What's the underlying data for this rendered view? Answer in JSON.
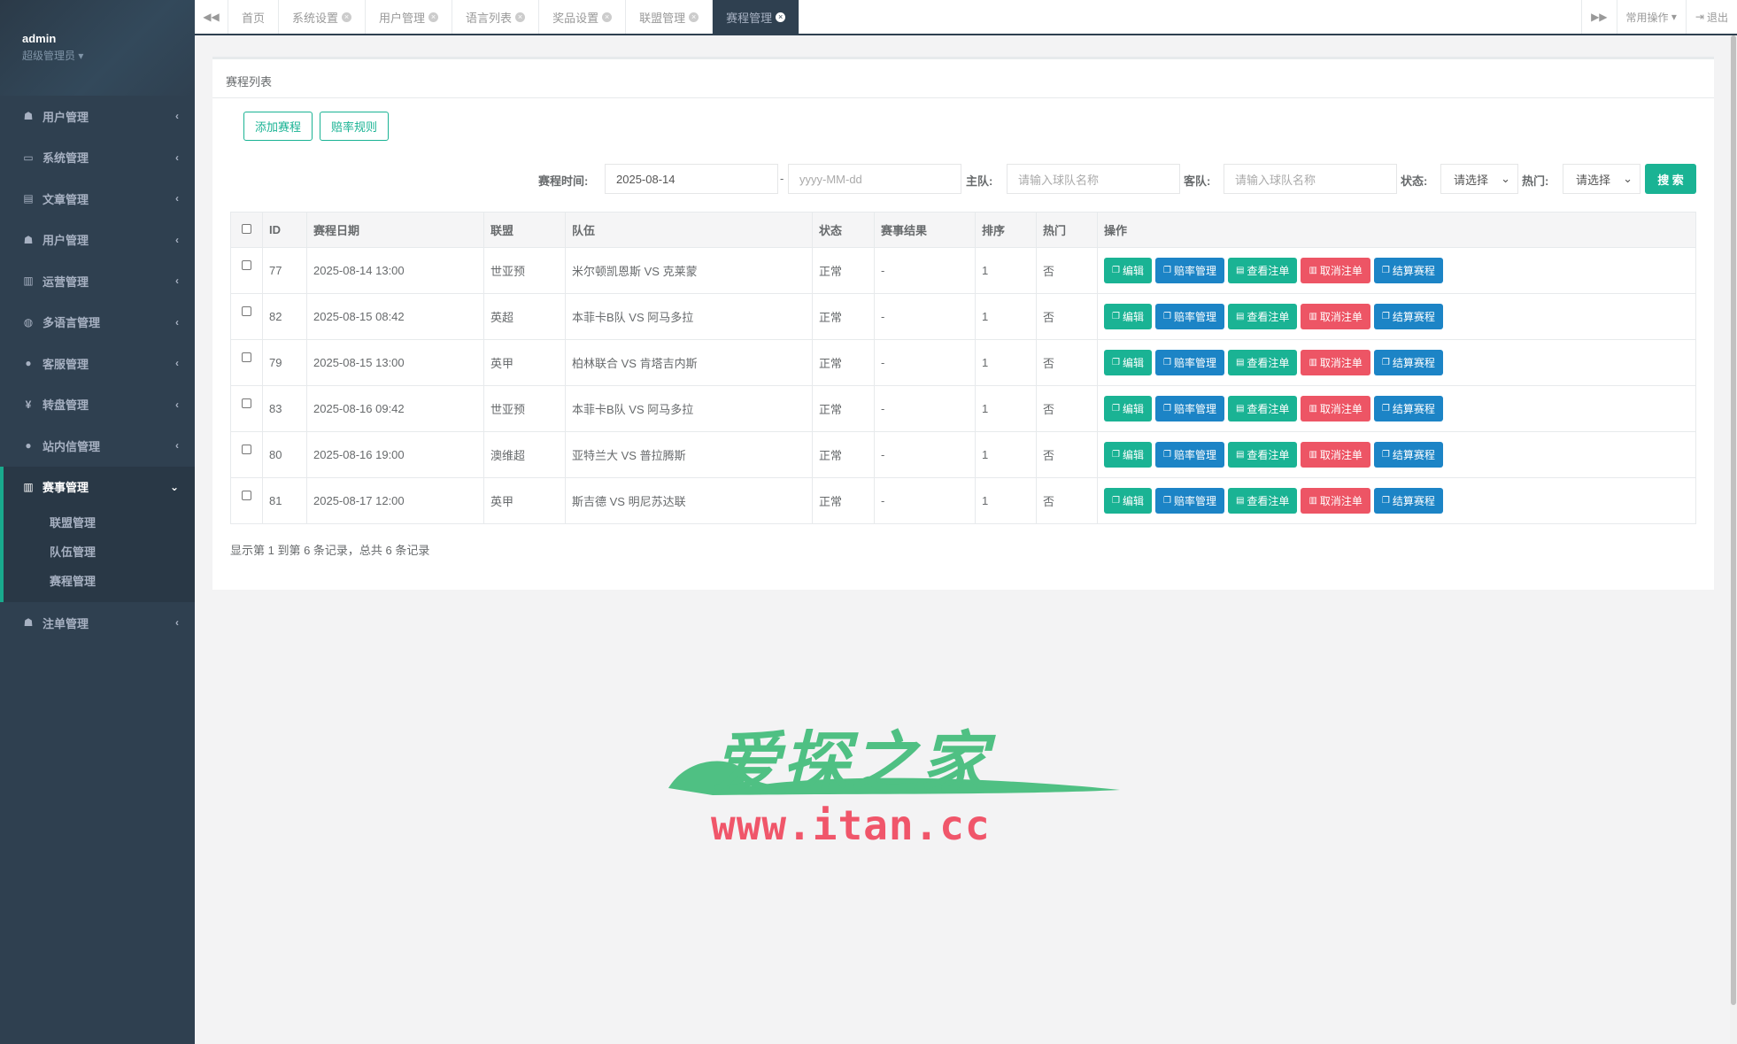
{
  "user": {
    "name": "admin",
    "role": "超级管理员"
  },
  "sidebar": {
    "items": [
      {
        "icon": "users-icon",
        "glyph": "☗",
        "label": "用户管理"
      },
      {
        "icon": "desktop-icon",
        "glyph": "▭",
        "label": "系统管理"
      },
      {
        "icon": "book-icon",
        "glyph": "▤",
        "label": "文章管理"
      },
      {
        "icon": "user-icon",
        "glyph": "☗",
        "label": "用户管理"
      },
      {
        "icon": "bar-chart-icon",
        "glyph": "▥",
        "label": "运营管理"
      },
      {
        "icon": "globe-icon",
        "glyph": "◍",
        "label": "多语言管理"
      },
      {
        "icon": "comment-icon",
        "glyph": "●",
        "label": "客服管理"
      },
      {
        "icon": "yen-icon",
        "glyph": "¥",
        "label": "转盘管理"
      },
      {
        "icon": "comment-icon",
        "glyph": "●",
        "label": "站内信管理"
      }
    ],
    "active_group": {
      "icon": "bar-chart-icon",
      "glyph": "▥",
      "label": "赛事管理",
      "children": [
        "联盟管理",
        "队伍管理",
        "赛程管理"
      ]
    },
    "after": [
      {
        "icon": "user-icon",
        "glyph": "☗",
        "label": "注单管理"
      }
    ]
  },
  "tabs": [
    {
      "label": "首页",
      "closable": false
    },
    {
      "label": "系统设置",
      "closable": true
    },
    {
      "label": "用户管理",
      "closable": true
    },
    {
      "label": "语言列表",
      "closable": true
    },
    {
      "label": "奖品设置",
      "closable": true
    },
    {
      "label": "联盟管理",
      "closable": true
    },
    {
      "label": "赛程管理",
      "closable": true,
      "active": true
    }
  ],
  "toolbar": {
    "common_ops": "常用操作",
    "logout": "退出"
  },
  "page": {
    "title": "赛程列表",
    "add_button": "添加赛程",
    "odds_rule_button": "赔率规则"
  },
  "filters": {
    "time_label": "赛程时间:",
    "time_start": "2025-08-14",
    "dash": "-",
    "time_end_placeholder": "yyyy-MM-dd",
    "home_label": "主队:",
    "home_placeholder": "请输入球队名称",
    "away_label": "客队:",
    "away_placeholder": "请输入球队名称",
    "status_label": "状态:",
    "status_value": "请选择",
    "hot_label": "热门:",
    "hot_value": "请选择",
    "search_button": "搜 索"
  },
  "table": {
    "headers": [
      "ID",
      "赛程日期",
      "联盟",
      "队伍",
      "状态",
      "赛事结果",
      "排序",
      "热门",
      "操作"
    ],
    "rows": [
      {
        "id": "77",
        "date": "2025-08-14 13:00",
        "league": "世亚预",
        "teams": "米尔顿凯恩斯  VS  克莱蒙",
        "status": "正常",
        "result": "-",
        "sort": "1",
        "hot": "否"
      },
      {
        "id": "82",
        "date": "2025-08-15 08:42",
        "league": "英超",
        "teams": "本菲卡B队  VS  阿马多拉",
        "status": "正常",
        "result": "-",
        "sort": "1",
        "hot": "否"
      },
      {
        "id": "79",
        "date": "2025-08-15 13:00",
        "league": "英甲",
        "teams": "柏林联合  VS  肯塔吉内斯",
        "status": "正常",
        "result": "-",
        "sort": "1",
        "hot": "否"
      },
      {
        "id": "83",
        "date": "2025-08-16 09:42",
        "league": "世亚预",
        "teams": "本菲卡B队  VS  阿马多拉",
        "status": "正常",
        "result": "-",
        "sort": "1",
        "hot": "否"
      },
      {
        "id": "80",
        "date": "2025-08-16 19:00",
        "league": "澳维超",
        "teams": "亚特兰大  VS  普拉腾斯",
        "status": "正常",
        "result": "-",
        "sort": "1",
        "hot": "否"
      },
      {
        "id": "81",
        "date": "2025-08-17 12:00",
        "league": "英甲",
        "teams": "斯吉德  VS  明尼苏达联",
        "status": "正常",
        "result": "-",
        "sort": "1",
        "hot": "否"
      }
    ],
    "actions": [
      {
        "label": "编辑",
        "color": "green",
        "icon": "copy-icon"
      },
      {
        "label": "赔率管理",
        "color": "blue",
        "icon": "copy-icon"
      },
      {
        "label": "查看注单",
        "color": "green",
        "icon": "list-icon"
      },
      {
        "label": "取消注单",
        "color": "red",
        "icon": "trash-icon"
      },
      {
        "label": "结算赛程",
        "color": "blue",
        "icon": "copy-icon"
      }
    ]
  },
  "pagination_info": "显示第 1 到第 6 条记录，总共 6 条记录",
  "watermark": {
    "title": "爱探之家",
    "url": "www.itan.cc"
  },
  "colors": {
    "sidebar": "#2f4050",
    "primary": "#1ab394",
    "info": "#1c84c6",
    "danger": "#ed5565"
  }
}
